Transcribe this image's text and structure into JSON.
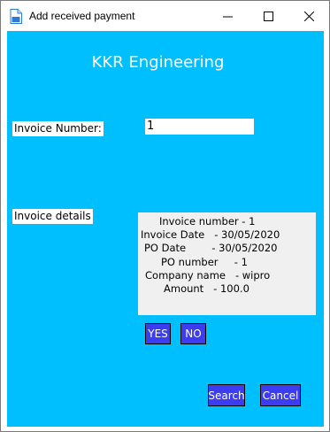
{
  "window": {
    "title": "Add received payment",
    "icon": "document-icon",
    "controls": [
      "minimize",
      "maximize",
      "close"
    ]
  },
  "heading": "KKR Engineering",
  "invoice_number": {
    "label": "Invoice Number:",
    "value": "1"
  },
  "invoice_details": {
    "label": "Invoice details",
    "lines": [
      "Invoice number - 1",
      "Invoice Date   - 30/05/2020",
      "PO Date        - 30/05/2020",
      "PO number     - 1",
      "Company name   - wipro",
      "Amount   - 100.0"
    ]
  },
  "buttons": {
    "yes": "YES",
    "no": "NO",
    "search": "Search",
    "cancel": "Cancel"
  },
  "colors": {
    "background": "#00bfff",
    "button": "#3c3cf0",
    "details_panel": "#f0f0f0"
  }
}
